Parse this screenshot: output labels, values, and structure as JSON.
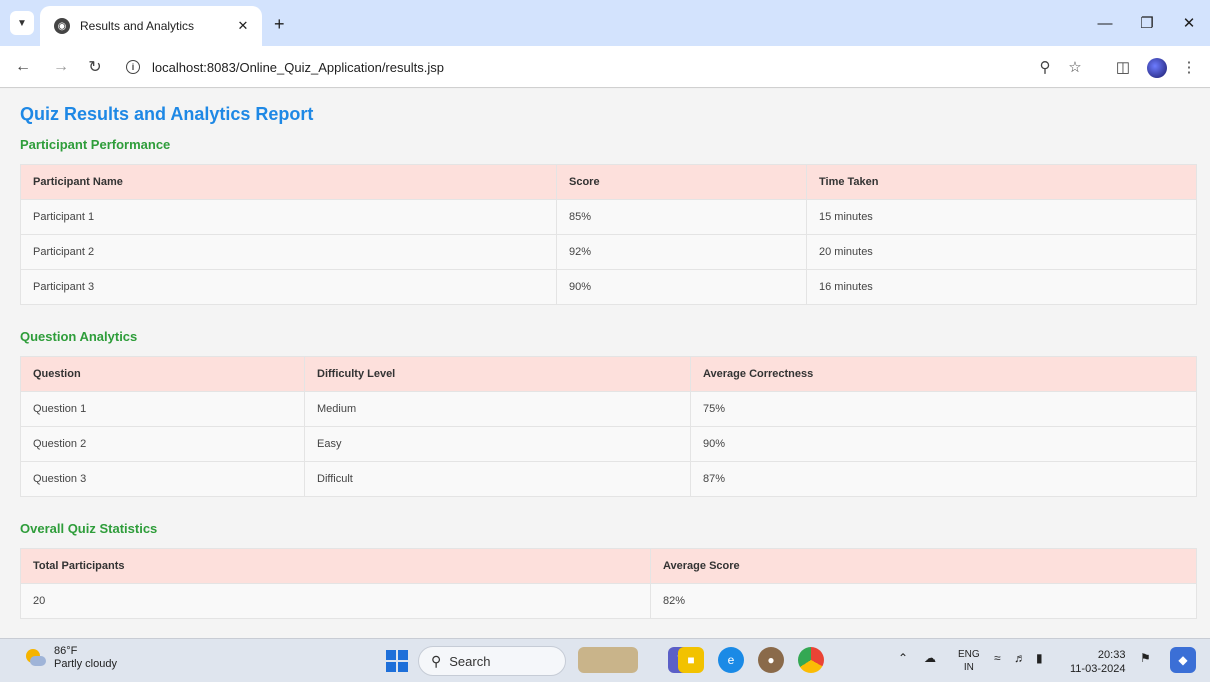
{
  "browser": {
    "tab_title": "Results and Analytics",
    "url": "localhost:8083/Online_Quiz_Application/results.jsp"
  },
  "page": {
    "title": "Quiz Results and Analytics Report",
    "participant_section": {
      "title": "Participant Performance",
      "headers": [
        "Participant Name",
        "Score",
        "Time Taken"
      ],
      "rows": [
        [
          "Participant 1",
          "85%",
          "15 minutes"
        ],
        [
          "Participant 2",
          "92%",
          "20 minutes"
        ],
        [
          "Participant 3",
          "90%",
          "16 minutes"
        ]
      ]
    },
    "question_section": {
      "title": "Question Analytics",
      "headers": [
        "Question",
        "Difficulty Level",
        "Average Correctness"
      ],
      "rows": [
        [
          "Question 1",
          "Medium",
          "75%"
        ],
        [
          "Question 2",
          "Easy",
          "90%"
        ],
        [
          "Question 3",
          "Difficult",
          "87%"
        ]
      ]
    },
    "overall_section": {
      "title": "Overall Quiz Statistics",
      "headers": [
        "Total Participants",
        "Average Score"
      ],
      "rows": [
        [
          "20",
          "82%"
        ]
      ]
    }
  },
  "taskbar": {
    "weather_temp": "86°F",
    "weather_desc": "Partly cloudy",
    "search_label": "Search",
    "lang_line1": "ENG",
    "lang_line2": "IN",
    "time": "20:33",
    "date": "11-03-2024"
  },
  "colors": {
    "page_title": "#1e88e5",
    "section_title": "#2e9d3a",
    "table_header_bg": "#fde0dc",
    "tabbar_bg": "#d3e3fd"
  },
  "icons": {
    "tab_list": "chevron-down-icon",
    "favicon": "globe-icon",
    "close": "close-icon",
    "new_tab": "plus-icon",
    "back": "back-arrow-icon",
    "forward": "forward-arrow-icon",
    "reload": "reload-icon",
    "site_info": "info-icon",
    "zoom": "zoom-icon",
    "bookmark": "star-icon",
    "side_panel": "side-panel-icon",
    "menu": "kebab-menu-icon"
  }
}
